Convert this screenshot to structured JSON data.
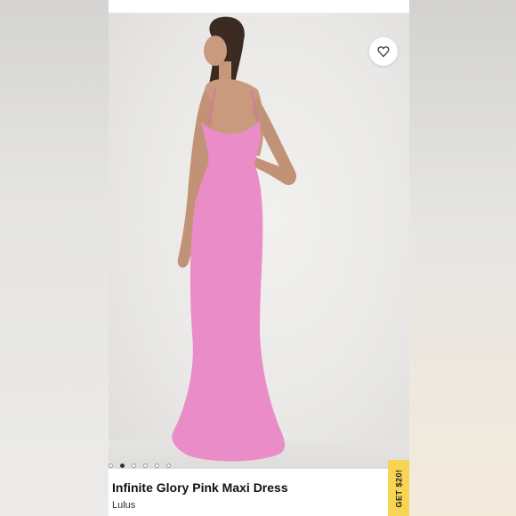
{
  "product": {
    "title": "Infinite Glory Pink Maxi Dress",
    "brand": "Lulus",
    "dress_color": "#e98cc8"
  },
  "gallery": {
    "total_images": 6,
    "active_index": 1
  },
  "favorite": {
    "icon": "heart-icon"
  },
  "cta": {
    "label": "GET $20!",
    "color": "#f7d453"
  }
}
